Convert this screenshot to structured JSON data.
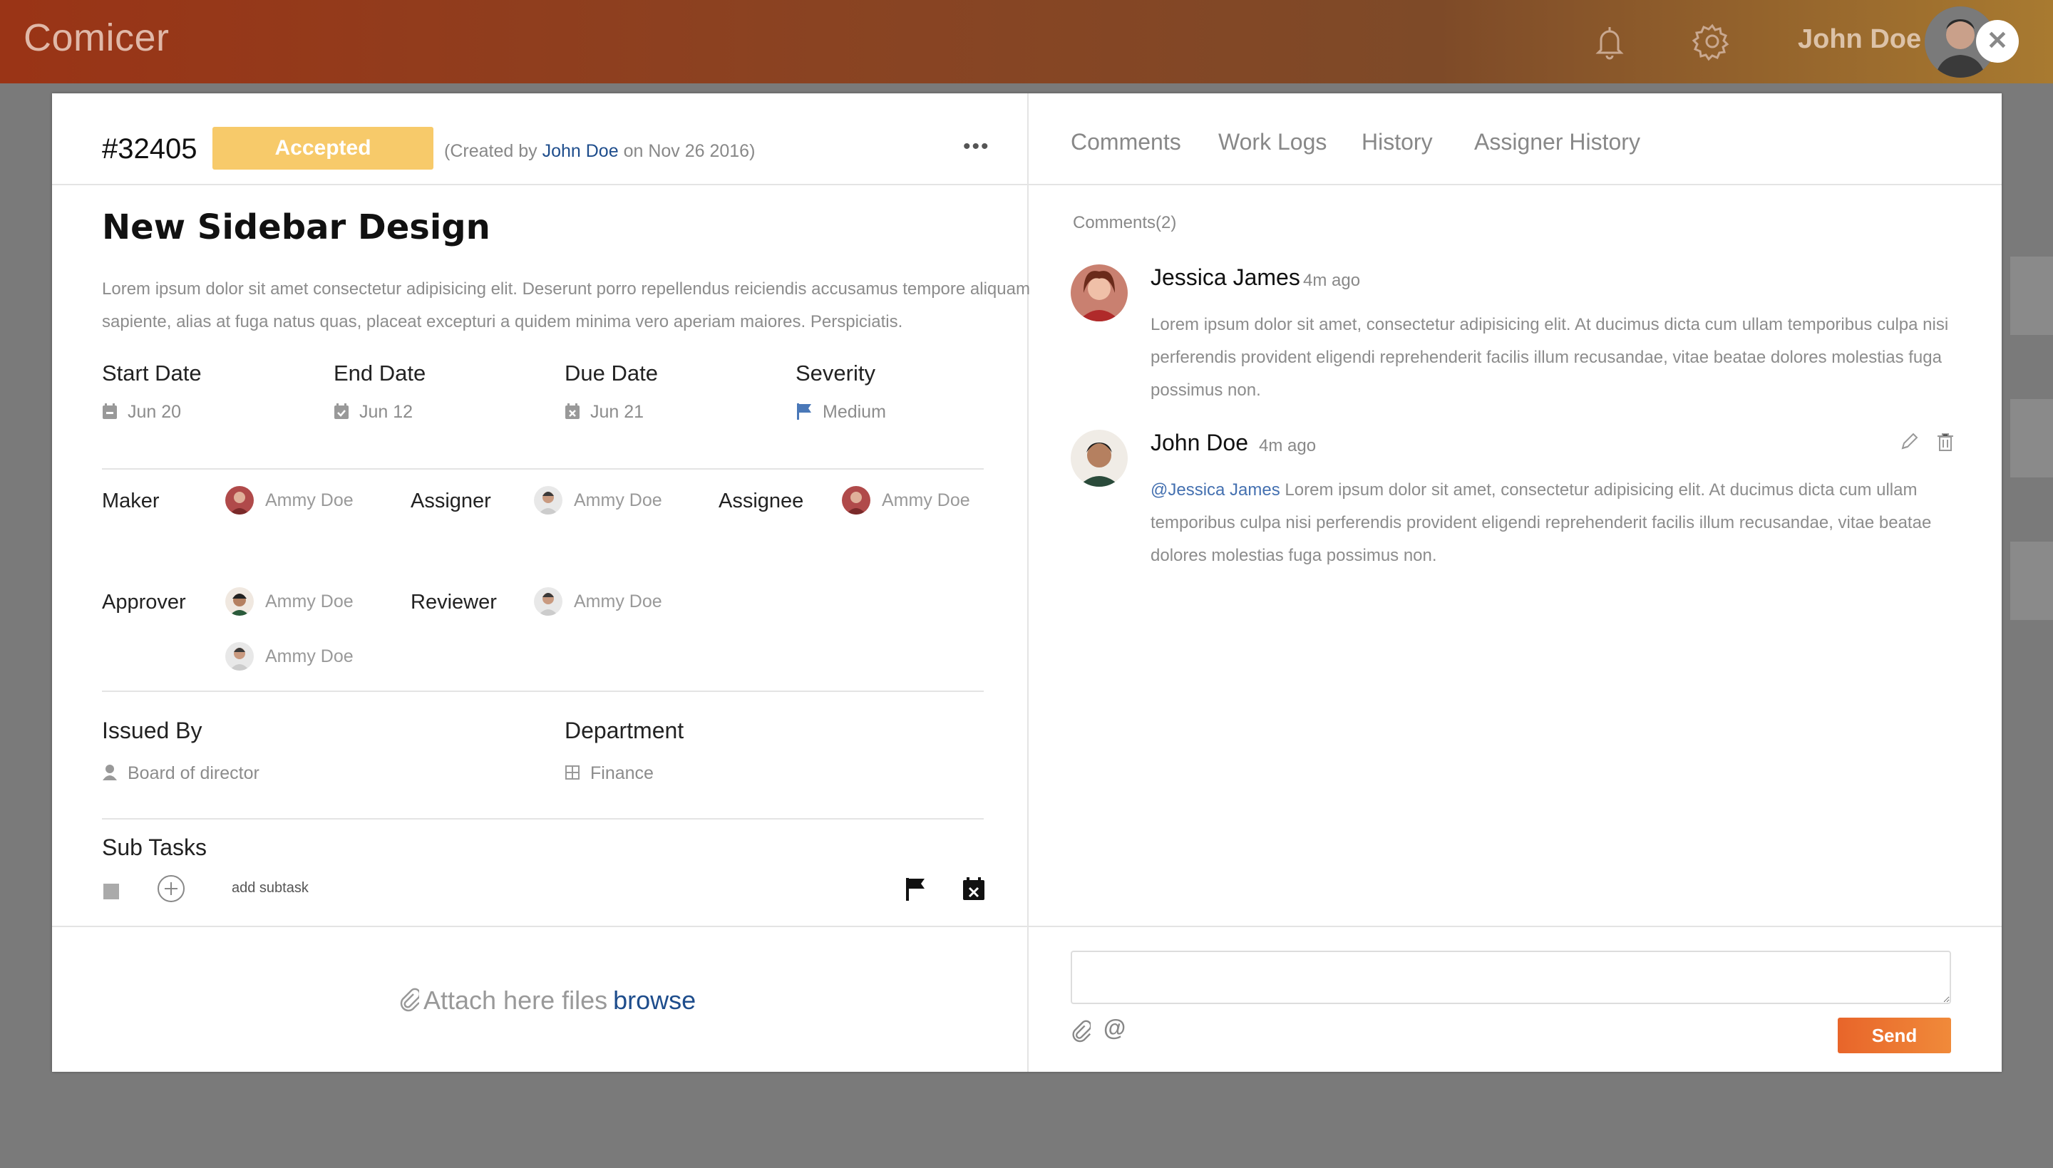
{
  "app": {
    "brand": "Comicer",
    "user_name": "John Doe"
  },
  "ticket": {
    "id": "#32405",
    "status": "Accepted",
    "created_prefix": "(Created by",
    "created_by": "John Doe",
    "created_suffix": "on Nov 26 2016)",
    "title": "New Sidebar Design",
    "description": "Lorem ipsum dolor sit amet consectetur adipisicing elit. Deserunt porro repellendus reiciendis accusamus tempore aliquam sapiente, alias at fuga natus quas, placeat excepturi a quidem minima vero aperiam maiores. Perspiciatis."
  },
  "dates": [
    {
      "label": "Start Date",
      "value": "Jun 20",
      "icon": "calendar-minus-icon"
    },
    {
      "label": "End Date",
      "value": "Jun 12",
      "icon": "calendar-check-icon"
    },
    {
      "label": "Due Date",
      "value": "Jun 21",
      "icon": "calendar-x-icon"
    },
    {
      "label": "Severity",
      "value": "Medium",
      "icon": "flag-icon"
    }
  ],
  "people": {
    "maker": {
      "label": "Maker",
      "name": "Ammy Doe"
    },
    "assigner": {
      "label": "Assigner",
      "name": "Ammy Doe"
    },
    "assignee": {
      "label": "Assignee",
      "name": "Ammy Doe"
    },
    "approver": {
      "label": "Approver",
      "names": [
        "Ammy Doe",
        "Ammy Doe"
      ]
    },
    "reviewer": {
      "label": "Reviewer",
      "name": "Ammy Doe"
    }
  },
  "issued": {
    "label": "Issued By",
    "value": "Board of director"
  },
  "department": {
    "label": "Department",
    "value": "Finance"
  },
  "subtasks": {
    "label": "Sub Tasks",
    "add_label": "add subtask"
  },
  "attach": {
    "text": "Attach here files",
    "browse": "browse"
  },
  "tabs": [
    "Comments",
    "Work Logs",
    "History",
    "Assigner History"
  ],
  "comments": {
    "count_label": "Comments(2)",
    "items": [
      {
        "author": "Jessica James",
        "time": "4m ago",
        "text": "Lorem ipsum dolor sit amet, consectetur adipisicing elit. At ducimus dicta cum ullam temporibus culpa nisi perferendis provident eligendi reprehenderit facilis illum recusandae, vitae beatae dolores molestias fuga possimus non."
      },
      {
        "author": "John Doe",
        "time": "4m ago",
        "mention": "@Jessica James",
        "text": "Lorem ipsum dolor sit amet, consectetur adipisicing elit. At ducimus dicta cum ullam temporibus culpa nisi perferendis provident eligendi reprehenderit facilis illum recusandae, vitae beatae dolores molestias fuga possimus non."
      }
    ]
  },
  "composer": {
    "send_label": "Send"
  },
  "colors": {
    "accent": "#f7ca6a",
    "send": "#ec7330",
    "link": "#1e4d8c",
    "mention": "#4470b0"
  }
}
